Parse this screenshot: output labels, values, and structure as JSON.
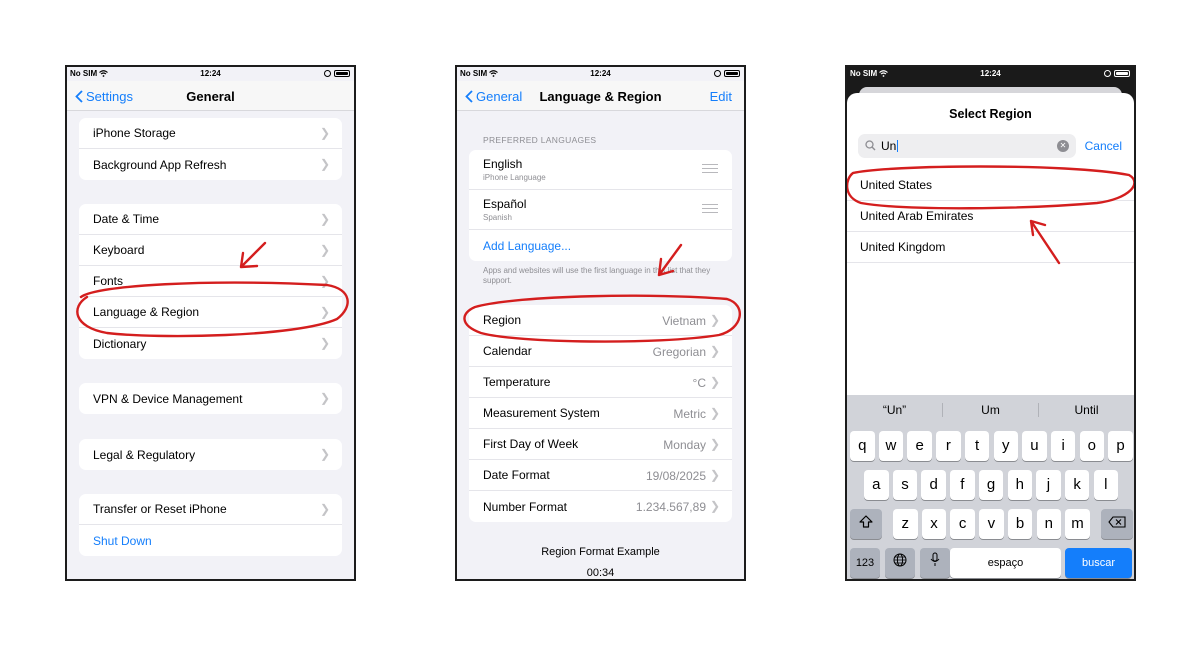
{
  "status": {
    "carrier": "No SIM",
    "time": "12:24"
  },
  "phone1": {
    "nav": {
      "back": "Settings",
      "title": "General"
    },
    "groups": [
      [
        "iPhone Storage",
        "Background App Refresh"
      ],
      [
        "Date & Time",
        "Keyboard",
        "Fonts",
        "Language & Region",
        "Dictionary"
      ],
      [
        "VPN & Device Management"
      ],
      [
        "Legal & Regulatory"
      ],
      [
        "Transfer or Reset iPhone",
        "Shut Down"
      ]
    ]
  },
  "phone2": {
    "nav": {
      "back": "General",
      "title": "Language & Region",
      "right": "Edit"
    },
    "section_label": "PREFERRED LANGUAGES",
    "languages": [
      {
        "name": "English",
        "sub": "iPhone Language"
      },
      {
        "name": "Español",
        "sub": "Spanish"
      }
    ],
    "add_language": "Add Language...",
    "footnote": "Apps and websites will use the first language in this list that they support.",
    "settings": [
      {
        "label": "Region",
        "value": "Vietnam"
      },
      {
        "label": "Calendar",
        "value": "Gregorian"
      },
      {
        "label": "Temperature",
        "value": "°C"
      },
      {
        "label": "Measurement System",
        "value": "Metric"
      },
      {
        "label": "First Day of Week",
        "value": "Monday"
      },
      {
        "label": "Date Format",
        "value": "19/08/2025"
      },
      {
        "label": "Number Format",
        "value": "1.234.567,89"
      }
    ],
    "format_example_title": "Region Format Example",
    "format_example_time": "00:34"
  },
  "phone3": {
    "title": "Select Region",
    "search_value": "Un",
    "cancel": "Cancel",
    "results": [
      "United States",
      "United Arab Emirates",
      "United Kingdom"
    ],
    "suggestions": [
      "“Un”",
      "Um",
      "Until"
    ],
    "keys": {
      "row1": [
        "q",
        "w",
        "e",
        "r",
        "t",
        "y",
        "u",
        "i",
        "o",
        "p"
      ],
      "row2": [
        "a",
        "s",
        "d",
        "f",
        "g",
        "h",
        "j",
        "k",
        "l"
      ],
      "row3": [
        "z",
        "x",
        "c",
        "v",
        "b",
        "n",
        "m"
      ],
      "numbers": "123",
      "space": "espaço",
      "go": "buscar"
    }
  },
  "colors": {
    "accent": "#147efb",
    "annotation": "#d41e1e"
  }
}
